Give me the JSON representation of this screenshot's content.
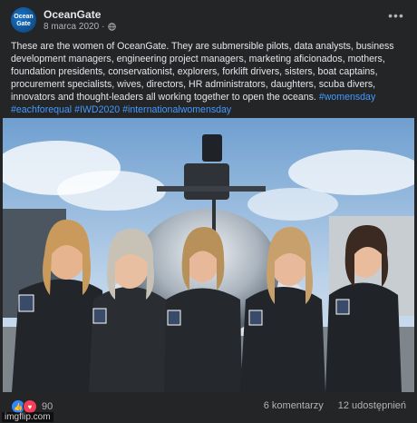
{
  "post": {
    "author": "OceanGate",
    "avatar_text": "Ocean Gate",
    "date": "8 marca 2020",
    "privacy_icon": "globe-icon",
    "more_icon": "more-options-icon",
    "text": "These are the women of OceanGate. They are submersible pilots, data analysts, business development managers, engineering project managers, marketing aficionados, mothers, foundation presidents, conservationist, explorers, forklift drivers, sisters, boat captains, procurement specialists, wives, directors, HR administrators, daughters, scuba divers, innovators and thought-leaders all working together to open the oceans.",
    "hashtags": "#womensday #eachforequal #IWD2020 #internationalwomensday"
  },
  "footer": {
    "reactions_count": "90",
    "comments": "6 komentarzy",
    "shares": "12 udostępnień",
    "like_color": "#2d88ff",
    "heart_color": "#f33e58"
  },
  "watermark": "imgflip.com"
}
